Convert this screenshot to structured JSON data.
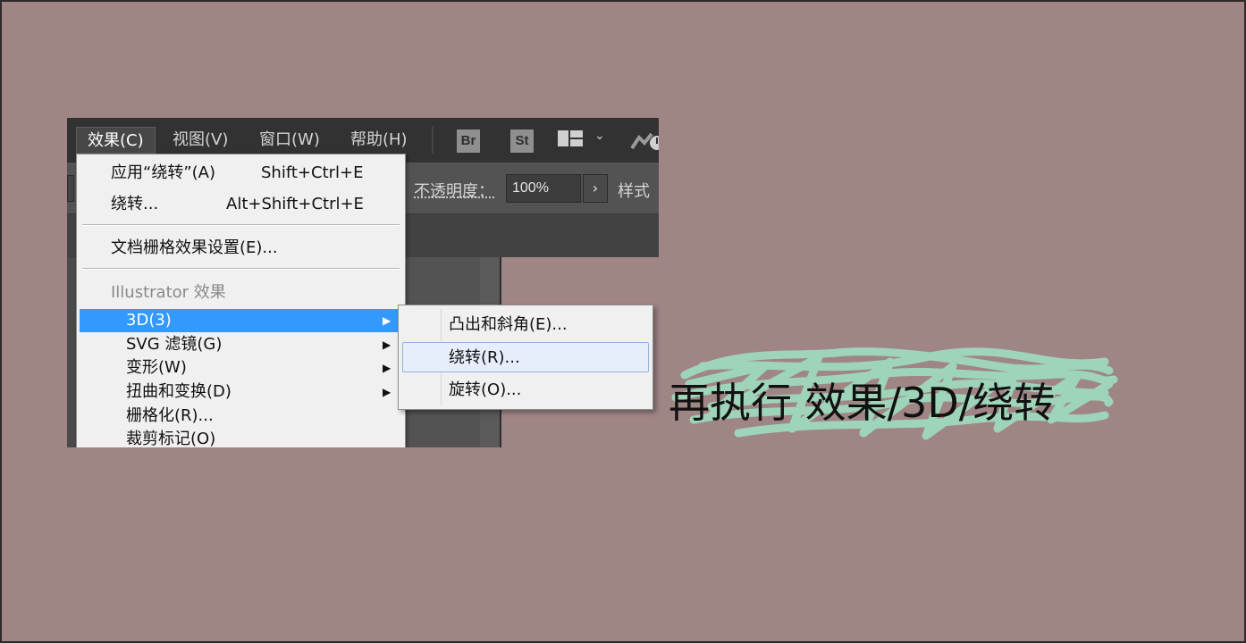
{
  "menubar": {
    "items": [
      {
        "label": "效果(C)",
        "active": true
      },
      {
        "label": "视图(V)"
      },
      {
        "label": "窗口(W)"
      },
      {
        "label": "帮助(H)"
      }
    ],
    "bridge_icon": "Br",
    "stock_icon": "St"
  },
  "control_bar": {
    "opacity_label": "不透明度：",
    "opacity_value": "100%",
    "style_label": "样式"
  },
  "effect_menu": {
    "apply_last": {
      "label": "应用“绕转”(A)",
      "shortcut": "Shift+Ctrl+E"
    },
    "last_effect": {
      "label": "绕转...",
      "shortcut": "Alt+Shift+Ctrl+E"
    },
    "raster_settings": "文档栅格效果设置(E)...",
    "section_header": "Illustrator 效果",
    "items": [
      {
        "label": "3D(3)",
        "submenu": true,
        "selected": true
      },
      {
        "label": "SVG 滤镜(G)",
        "submenu": true
      },
      {
        "label": "变形(W)",
        "submenu": true
      },
      {
        "label": "扭曲和变换(D)",
        "submenu": true
      },
      {
        "label": "栅格化(R)..."
      },
      {
        "label": "裁剪标记(O)"
      }
    ]
  },
  "submenu_3d": {
    "items": [
      {
        "label": "凸出和斜角(E)..."
      },
      {
        "label": "绕转(R)...",
        "hover": true
      },
      {
        "label": "旋转(O)..."
      }
    ]
  },
  "annotation": {
    "text": "再执行 效果/3D/绕转"
  },
  "colors": {
    "background": "#a08585",
    "menu_highlight": "#3399ff",
    "scribble": "#9ed9bd"
  }
}
